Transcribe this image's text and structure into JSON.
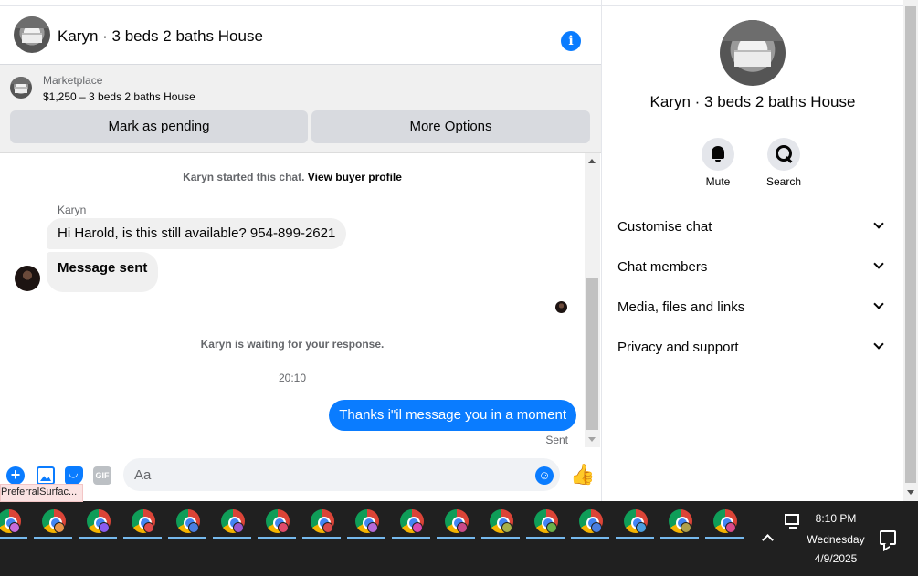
{
  "header": {
    "title": "Karyn · 3 beds 2 baths House",
    "info_icon": "i"
  },
  "marketplace": {
    "label": "Marketplace",
    "listing": "$1,250 – 3 beds 2 baths House",
    "mark_pending": "Mark as pending",
    "more_options": "More Options"
  },
  "messages": {
    "started_text": "Karyn started this chat.",
    "view_profile": "View buyer profile",
    "sender_name": "Karyn",
    "msg1": "Hi Harold, is this still available? 954-899-2621",
    "msg2": "Message sent",
    "waiting": "Karyn is waiting for your response.",
    "timestamp": "20:10",
    "outgoing": "Thanks i\"il message you in a moment",
    "sent_status": "Sent"
  },
  "composer": {
    "placeholder": "Aa",
    "plus_glyph": "+",
    "gif_label": "GIF",
    "emoji_glyph": "☺",
    "like_glyph": "👍"
  },
  "tooltip": "PreferralSurfac...",
  "details": {
    "title": "Karyn · 3 beds 2 baths House",
    "mute": "Mute",
    "search": "Search",
    "sections": [
      "Customise chat",
      "Chat members",
      "Media, files and links",
      "Privacy and support"
    ]
  },
  "taskbar": {
    "apps": [
      {
        "profile_color": "#c76bd9"
      },
      {
        "profile_color": "#e8954a"
      },
      {
        "profile_color": "#8a5cf0"
      },
      {
        "profile_color": "#e04b4b"
      },
      {
        "profile_color": "#4a7ee0"
      },
      {
        "profile_color": "#9b59d0"
      },
      {
        "profile_color": "#e04b6b"
      },
      {
        "profile_color": "#d94a4a"
      },
      {
        "profile_color": "#b56bd9"
      },
      {
        "profile_color": "#d94ab0"
      },
      {
        "profile_color": "#c94a8a"
      },
      {
        "profile_color": "#a8b04a"
      },
      {
        "profile_color": "#6ab04a"
      },
      {
        "profile_color": "#4a7ee0"
      },
      {
        "profile_color": "#4a9ee0"
      },
      {
        "profile_color": "#b0a04a"
      },
      {
        "profile_color": "#d94a8a"
      }
    ],
    "time": "8:10 PM",
    "day": "Wednesday",
    "date": "4/9/2025"
  },
  "colors": {
    "accent": "#0a7cff",
    "taskbar": "#202020"
  }
}
